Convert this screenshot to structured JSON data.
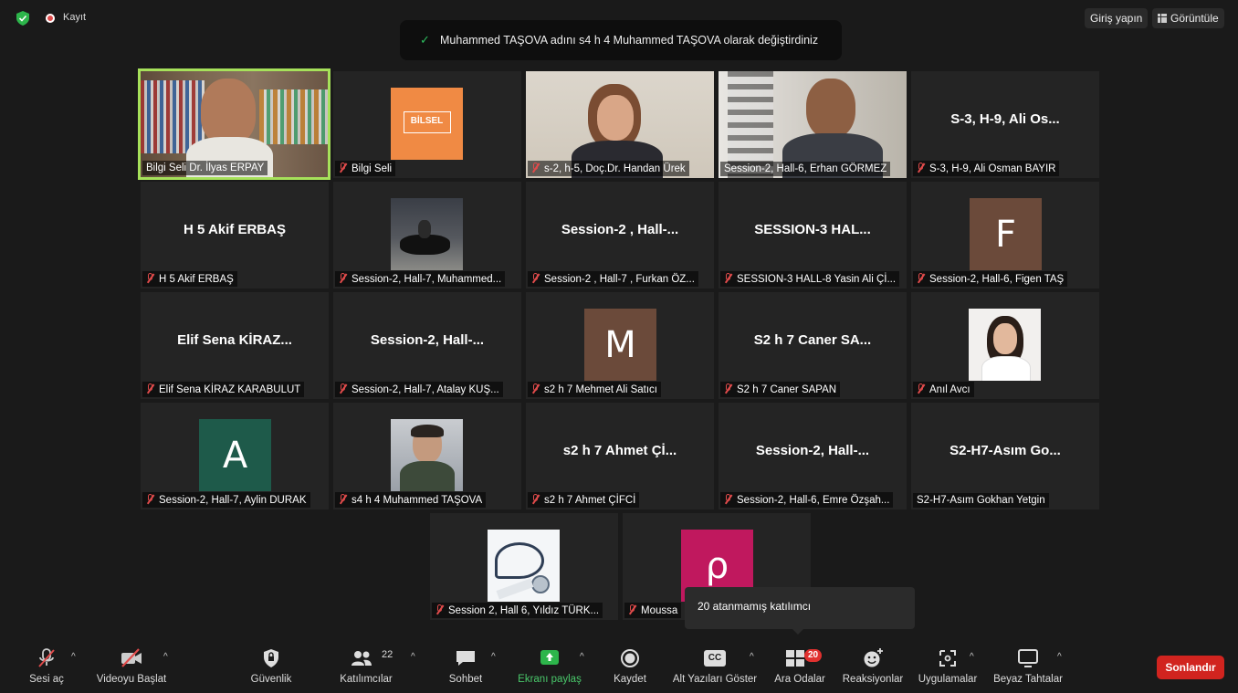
{
  "topbar": {
    "recording_label": "Kayıt",
    "login_label": "Giriş yapın",
    "view_label": "Görüntüle"
  },
  "notification": {
    "text": "Muhammed TAŞOVA adını s4 h 4 Muhammed TAŞOVA olarak değiştirdiniz"
  },
  "participants": [
    {
      "label": "Bilgi Seli Dr. İlyas ERPAY",
      "big_name": "",
      "kind": "video",
      "muted": false,
      "active": true
    },
    {
      "label": "Bilgi Seli",
      "big_name": "",
      "kind": "logo",
      "logo_text": "BİLSEL",
      "muted": true
    },
    {
      "label": "s-2, h-5, Doç.Dr. Handan Ürek",
      "big_name": "",
      "kind": "video",
      "muted": true
    },
    {
      "label": "Session-2, Hall-6, Erhan GÖRMEZ",
      "big_name": "",
      "kind": "video",
      "muted": false
    },
    {
      "label": "S-3, H-9, Ali Osman BAYIR",
      "big_name": "S-3, H-9, Ali Os...",
      "kind": "name",
      "muted": true
    },
    {
      "label": "H 5  Akif ERBAŞ",
      "big_name": "H 5  Akif ERBAŞ",
      "kind": "name",
      "muted": true
    },
    {
      "label": "Session-2, Hall-7, Muhammed...",
      "big_name": "",
      "kind": "photo",
      "muted": true
    },
    {
      "label": "Session-2 , Hall-7 , Furkan ÖZ...",
      "big_name": "Session-2 , Hall-...",
      "kind": "name",
      "muted": true
    },
    {
      "label": "SESSION-3 HALL-8 Yasin Ali Çİ...",
      "big_name": "SESSION-3  HAL...",
      "kind": "name",
      "muted": true
    },
    {
      "label": "Session-2, Hall-6, Figen TAŞ",
      "big_name": "",
      "kind": "avatar",
      "letter": "F",
      "color": "#6b4a3a",
      "muted": true
    },
    {
      "label": "Elif Sena KİRAZ KARABULUT",
      "big_name": "Elif Sena KİRAZ...",
      "kind": "name",
      "muted": true
    },
    {
      "label": "Session-2, Hall-7, Atalay KUŞ...",
      "big_name": "Session-2,  Hall-...",
      "kind": "name",
      "muted": true
    },
    {
      "label": "s2 h 7 Mehmet Ali Satıcı",
      "big_name": "",
      "kind": "avatar",
      "letter": "M",
      "color": "#6b4a3a",
      "muted": true
    },
    {
      "label": "S2 h 7 Caner SAPAN",
      "big_name": "S2 h 7 Caner SA...",
      "kind": "name",
      "muted": true
    },
    {
      "label": "Anıl Avcı",
      "big_name": "",
      "kind": "photo",
      "muted": true
    },
    {
      "label": "Session-2, Hall-7, Aylin DURAK",
      "big_name": "",
      "kind": "avatar",
      "letter": "A",
      "color": "#1e5a4a",
      "muted": true
    },
    {
      "label": "s4 h 4 Muhammed TAŞOVA",
      "big_name": "",
      "kind": "photo",
      "muted": true
    },
    {
      "label": "s2 h 7 Ahmet ÇİFCİ",
      "big_name": "s2 h 7 Ahmet Çİ...",
      "kind": "name",
      "muted": true
    },
    {
      "label": "Session-2, Hall-6, Emre Özşah...",
      "big_name": "Session-2,  Hall-...",
      "kind": "name",
      "muted": true
    },
    {
      "label": "S2-H7-Asım Gokhan Yetgin",
      "big_name": "S2-H7-Asım  Go...",
      "kind": "name",
      "muted": false
    },
    {
      "label": "Session 2, Hall 6, Yıldız TÜRK...",
      "big_name": "",
      "kind": "photo",
      "muted": true
    },
    {
      "label": "Moussa",
      "big_name": "",
      "kind": "avatar",
      "letter": "ρ",
      "color": "#c0185e",
      "muted": true
    }
  ],
  "tooltip": {
    "text": "20 atanmamış katılımcı"
  },
  "toolbar": {
    "unmute": "Sesi aç",
    "start_video": "Videoyu Başlat",
    "security": "Güvenlik",
    "participants": "Katılımcılar",
    "participants_count": "22",
    "chat": "Sohbet",
    "share_screen": "Ekranı paylaş",
    "record": "Kaydet",
    "captions": "Alt Yazıları Göster",
    "captions_icon_text": "CC",
    "breakout": "Ara Odalar",
    "breakout_badge": "20",
    "reactions": "Reaksiyonlar",
    "apps": "Uygulamalar",
    "whiteboards": "Beyaz Tahtalar",
    "end": "Sonlandır"
  },
  "colors": {
    "active_speaker_border": "#a6e15a",
    "end_button": "#d1241f",
    "share_green": "#2db54b",
    "muted_red": "#e04b4b"
  }
}
